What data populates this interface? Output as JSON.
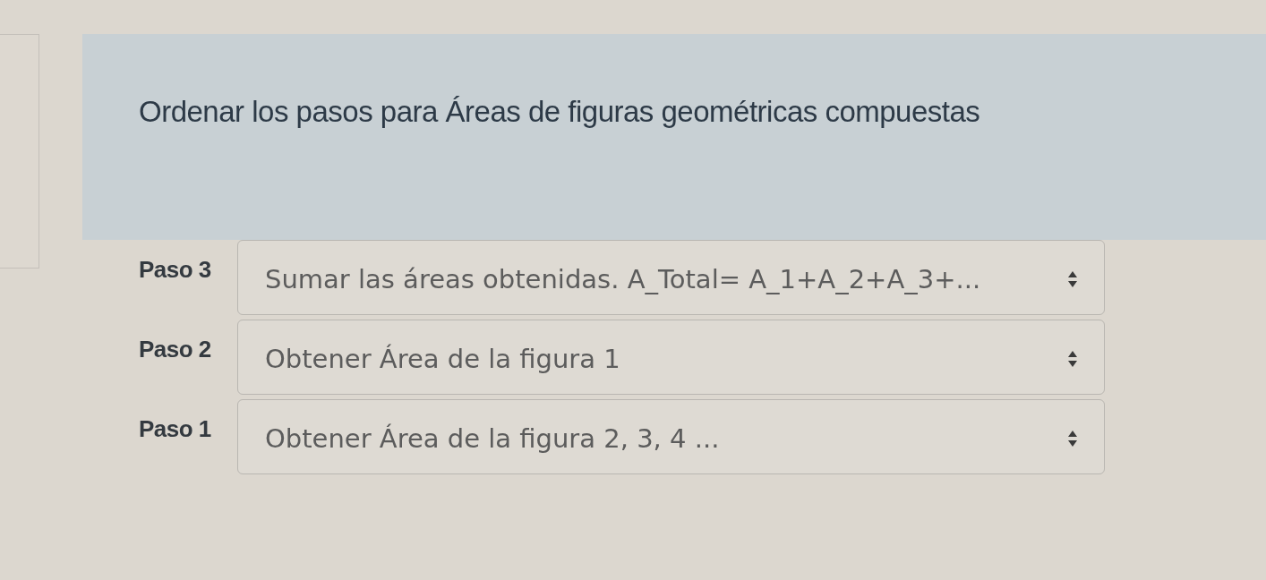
{
  "question": {
    "title": "Ordenar los pasos para Áreas de figuras geométricas compuestas"
  },
  "steps": [
    {
      "label": "Paso 3",
      "value": "Sumar las áreas obtenidas. A_Total= A_1+A_2+A_3+..."
    },
    {
      "label": "Paso 2",
      "value": "Obtener Área de la figura 1"
    },
    {
      "label": "Paso 1",
      "value": "Obtener Área de la figura 2, 3, 4 ..."
    }
  ]
}
